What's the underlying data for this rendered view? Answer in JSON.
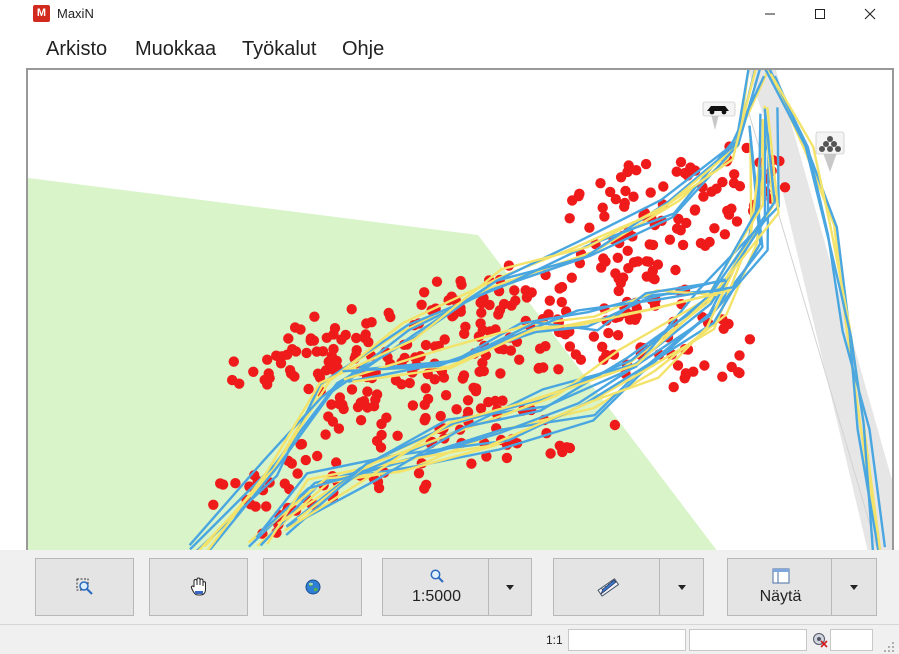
{
  "window": {
    "title": "MaxiN",
    "icon": "maxin-app-icon"
  },
  "menu": {
    "items": [
      "Arkisto",
      "Muokkaa",
      "Työkalut",
      "Ohje"
    ]
  },
  "map": {
    "icons": [
      "car-icon",
      "tree-group-icon"
    ],
    "colors": {
      "field": "#d8f4c8",
      "road": "#e6e6e6",
      "track_blue": "#4aa6e0",
      "track_yellow": "#f3e36a",
      "points": "#ef1b1b"
    }
  },
  "toolbar": {
    "zoom_icon": "zoom-select-icon",
    "pan_icon": "hand-pan-icon",
    "globe_icon": "globe-icon",
    "scale_label": "1:5000",
    "measure_icon": "ruler-pencil-icon",
    "show_label": "Näytä"
  },
  "statusbar": {
    "scale_text": "1:1"
  }
}
